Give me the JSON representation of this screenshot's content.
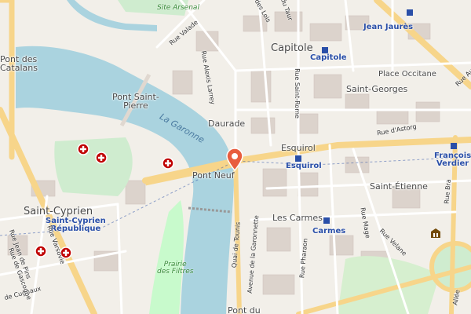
{
  "map": {
    "place_labels": {
      "capitole": "Capitole",
      "pont_saint_pierre": "Pont Saint-\nPierre",
      "daurade": "Daurade",
      "esquirol": "Esquirol",
      "pont_neuf": "Pont Neuf",
      "saint_georges": "Saint-Georges",
      "place_occitane": "Place Occitane",
      "saint_etienne": "Saint-Étienne",
      "saint_cyprien": "Saint-Cyprien",
      "les_carmes": "Les Carmes",
      "pont_des_catalans": "Pont des\nCatalans",
      "pont_du": "Pont du",
      "site_arsenal": "Site Arsenal"
    },
    "metro_labels": {
      "jean_jaures": "Jean Jaurès",
      "capitole": "Capitole",
      "esquirol": "Esquirol",
      "francois_verdier": "François\nVerdier",
      "saint_cyprien_republique": "Saint-Cyprien\nRépublique",
      "carmes": "Carmes"
    },
    "street_labels": {
      "rue_valade": "Rue Valade",
      "rue_alexis_larrey": "Rue Alexis Larrey",
      "rue_saint_rome": "Rue Saint-Rome",
      "quai_de_tounis": "Quai de Tounis",
      "avenue_de_la_garonnelle": "Avenue de la Garonnette",
      "rue_pharaon": "Rue Pharaon",
      "rue_mage": "Rue Mage",
      "rue_velane": "Rue Velane",
      "rue_d_astorg": "Rue d'Astorg",
      "rue_de_cugnaux": "de Cugnaux",
      "rue_varsovie": "Rue Varsovie",
      "rue_jean_de_pins": "Rue Jean de Pins",
      "rue_de_gascogne": "Rue de Gascogne",
      "rue_du_taur": "du Taur",
      "rue_des_lois": "des Lois",
      "allees": "Allée",
      "rue_bra": "Rue Bra",
      "rue_au": "Rue Au"
    },
    "water_label": "La Garonne",
    "park_label": "Prairie\ndes Filtres",
    "colors": {
      "water": "#aad3df",
      "park": "#c8facc",
      "building": "#d9d0c9",
      "road_major": "#f7d58a",
      "road_minor": "#ffffff",
      "metro": "#2a4fa8",
      "hospital": "#c00000",
      "marker": "#e85d3f"
    },
    "icons": [
      "location-pin-icon",
      "hospital-icon",
      "museum-icon",
      "metro-station-icon"
    ]
  }
}
